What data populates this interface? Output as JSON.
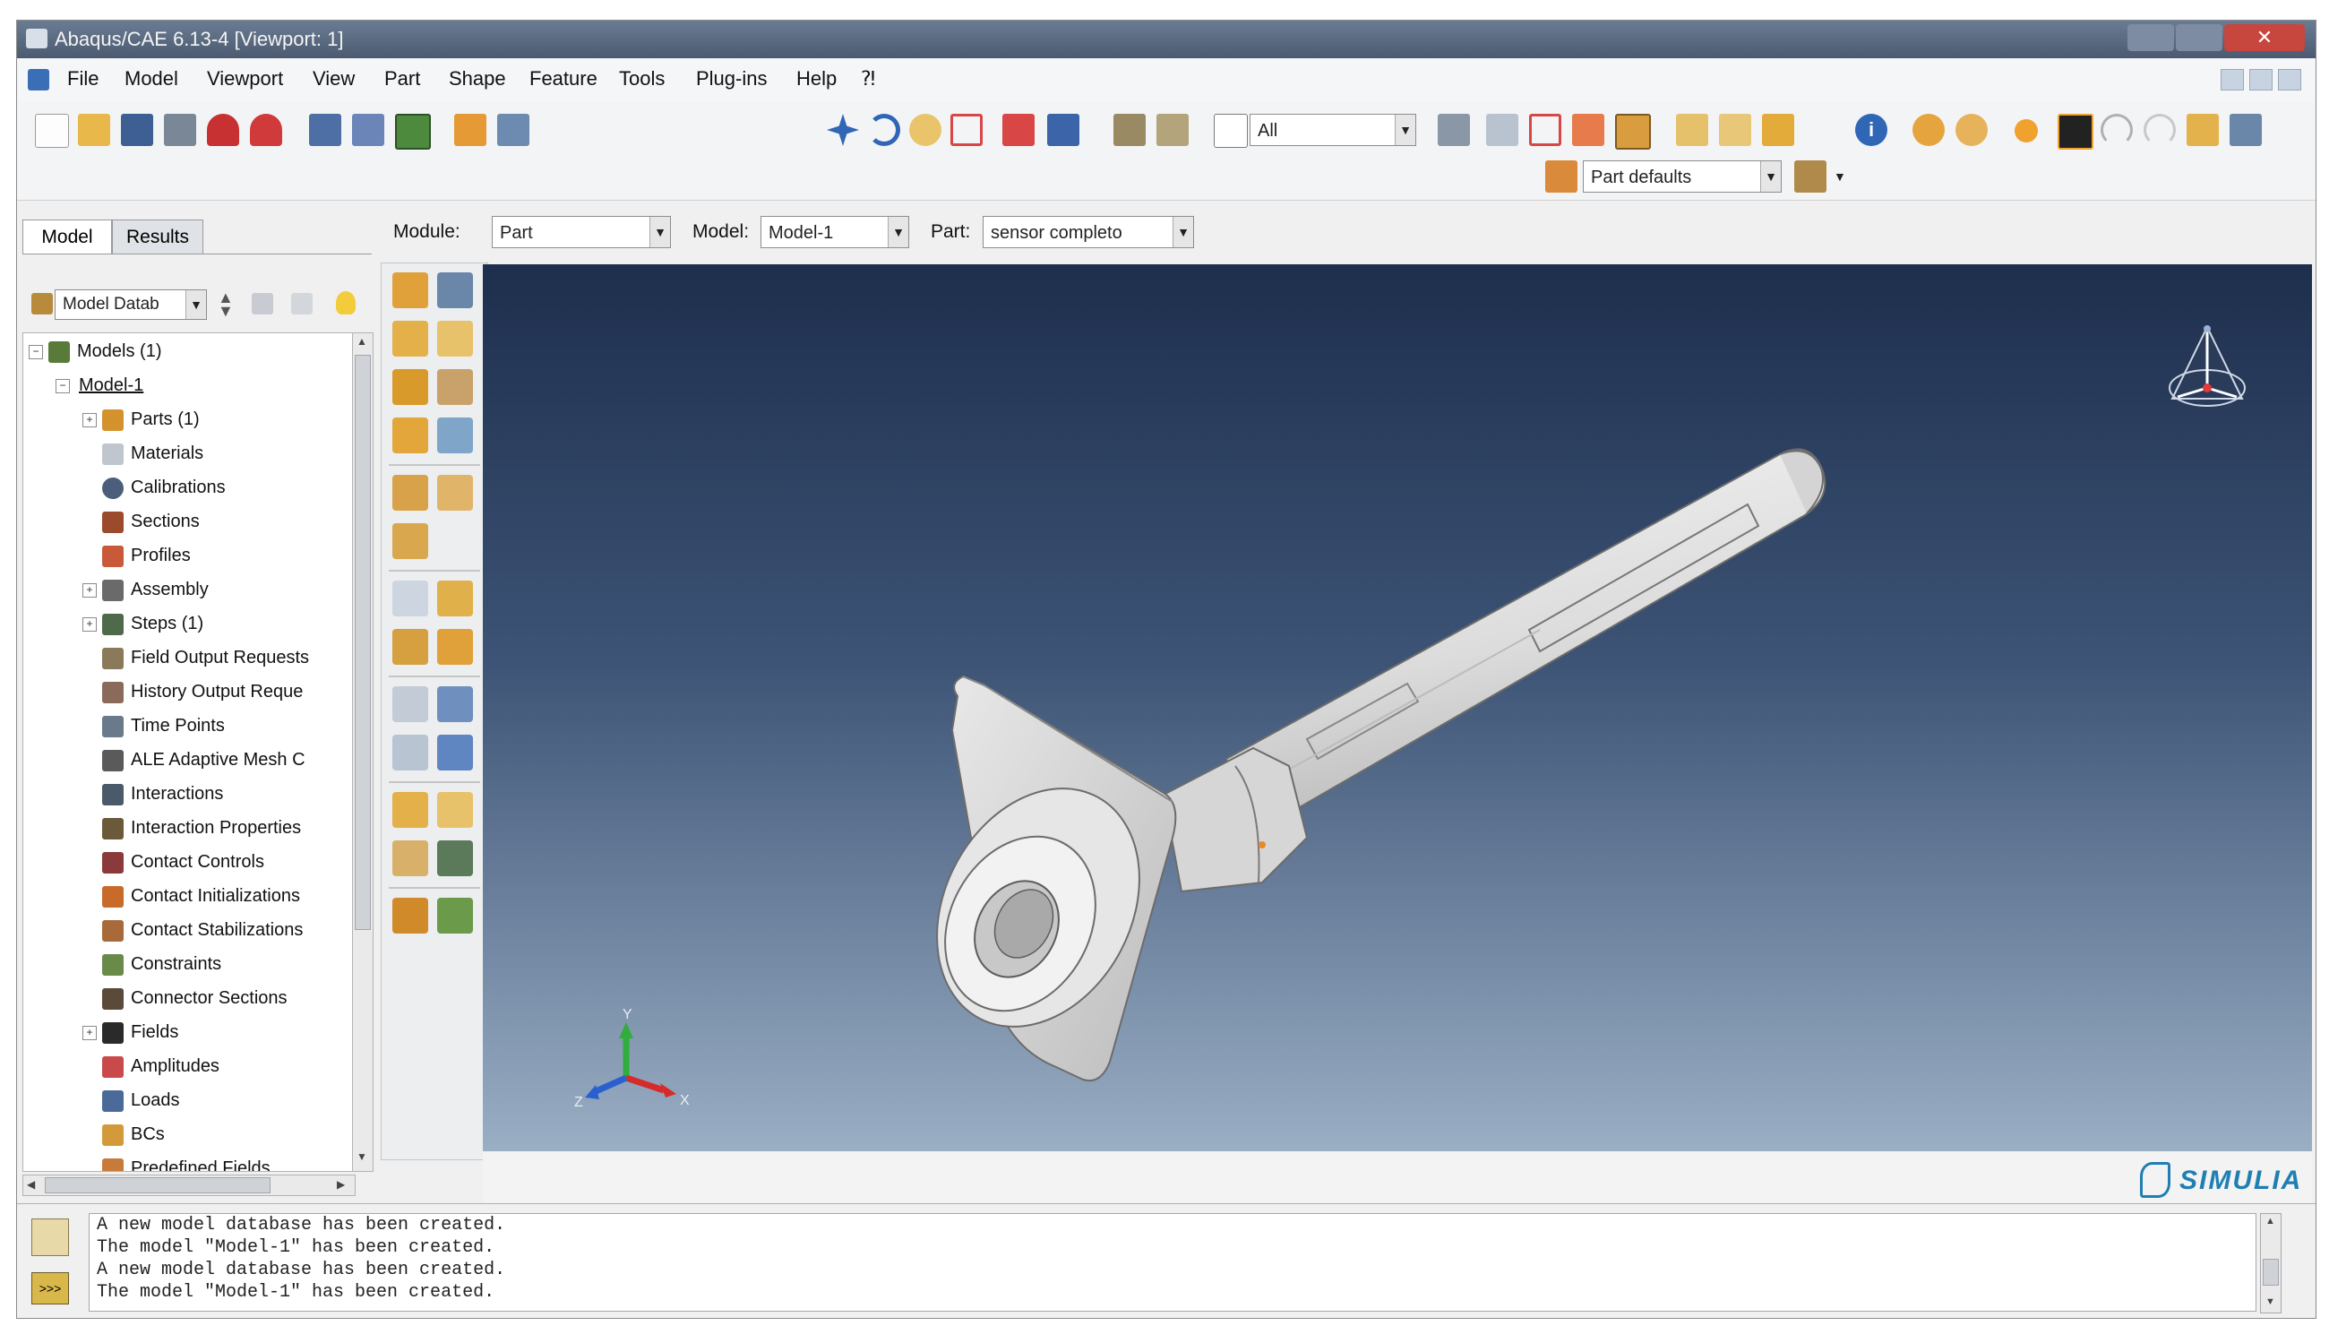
{
  "window": {
    "title": "Abaqus/CAE 6.13-4 [Viewport: 1]"
  },
  "menu": [
    "File",
    "Model",
    "Viewport",
    "View",
    "Part",
    "Shape",
    "Feature",
    "Tools",
    "Plug-ins",
    "Help",
    "⁈"
  ],
  "toolbar": {
    "selection_filter": "All",
    "part_defaults": "Part defaults"
  },
  "context": {
    "module_label": "Module:",
    "module_value": "Part",
    "model_label": "Model:",
    "model_value": "Model-1",
    "part_label": "Part:",
    "part_value": "sensor completo"
  },
  "tabs": [
    "Model",
    "Results"
  ],
  "tree_selector": "Model Datab",
  "tree": [
    {
      "label": "Models (1)",
      "level": 0,
      "expander": "−",
      "icon": "models-icon"
    },
    {
      "label": "Model-1",
      "level": 1,
      "expander": "−",
      "icon": ""
    },
    {
      "label": "Parts (1)",
      "level": 2,
      "expander": "+",
      "icon": "parts-icon"
    },
    {
      "label": "Materials",
      "level": 2,
      "expander": "",
      "icon": "materials-icon"
    },
    {
      "label": "Calibrations",
      "level": 2,
      "expander": "",
      "icon": "calibrations-icon"
    },
    {
      "label": "Sections",
      "level": 2,
      "expander": "",
      "icon": "sections-icon"
    },
    {
      "label": "Profiles",
      "level": 2,
      "expander": "",
      "icon": "profiles-icon"
    },
    {
      "label": "Assembly",
      "level": 2,
      "expander": "+",
      "icon": "assembly-icon"
    },
    {
      "label": "Steps (1)",
      "level": 2,
      "expander": "+",
      "icon": "steps-icon"
    },
    {
      "label": "Field Output Requests",
      "level": 2,
      "expander": "",
      "icon": "field-output-icon"
    },
    {
      "label": "History Output Reque",
      "level": 2,
      "expander": "",
      "icon": "history-output-icon"
    },
    {
      "label": "Time Points",
      "level": 2,
      "expander": "",
      "icon": "time-points-icon"
    },
    {
      "label": "ALE Adaptive Mesh C",
      "level": 2,
      "expander": "",
      "icon": "ale-mesh-icon"
    },
    {
      "label": "Interactions",
      "level": 2,
      "expander": "",
      "icon": "interactions-icon"
    },
    {
      "label": "Interaction Properties",
      "level": 2,
      "expander": "",
      "icon": "interaction-properties-icon"
    },
    {
      "label": "Contact Controls",
      "level": 2,
      "expander": "",
      "icon": "contact-controls-icon"
    },
    {
      "label": "Contact Initializations",
      "level": 2,
      "expander": "",
      "icon": "contact-initializations-icon"
    },
    {
      "label": "Contact Stabilizations",
      "level": 2,
      "expander": "",
      "icon": "contact-stabilizations-icon"
    },
    {
      "label": "Constraints",
      "level": 2,
      "expander": "",
      "icon": "constraints-icon"
    },
    {
      "label": "Connector Sections",
      "level": 2,
      "expander": "",
      "icon": "connector-sections-icon"
    },
    {
      "label": "Fields",
      "level": 2,
      "expander": "+",
      "icon": "fields-icon"
    },
    {
      "label": "Amplitudes",
      "level": 2,
      "expander": "",
      "icon": "amplitudes-icon"
    },
    {
      "label": "Loads",
      "level": 2,
      "expander": "",
      "icon": "loads-icon"
    },
    {
      "label": "BCs",
      "level": 2,
      "expander": "",
      "icon": "bcs-icon"
    },
    {
      "label": "Predefined Fields",
      "level": 2,
      "expander": "",
      "icon": "predefined-fields-icon"
    }
  ],
  "triad": {
    "x": "X",
    "y": "Y",
    "z": "Z"
  },
  "brand": "SIMULIA",
  "messages": [
    "A new model database has been created.",
    "The model \"Model-1\" has been created.",
    "A new model database has been created.",
    "The model \"Model-1\" has been created."
  ]
}
